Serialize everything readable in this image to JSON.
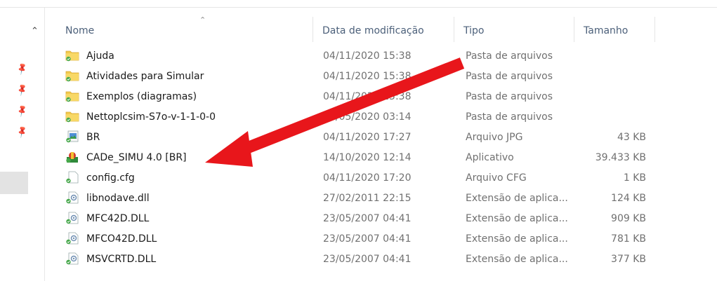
{
  "columns": {
    "name": "Nome",
    "date": "Data de modificação",
    "type": "Tipo",
    "size": "Tamanho"
  },
  "icons": {
    "folder": "folder-icon",
    "image": "image-file-icon",
    "app": "application-icon",
    "config": "config-file-icon",
    "dll": "dll-file-icon",
    "pin": "pin-icon"
  },
  "colors": {
    "arrow": "#e8161b",
    "header_text": "#4c607a",
    "folder_yellow": "#f3c94c"
  },
  "files": [
    {
      "name": "Ajuda",
      "date": "04/11/2020 15:38",
      "type": "Pasta de arquivos",
      "size": "",
      "icon": "folder"
    },
    {
      "name": "Atividades para Simular",
      "date": "04/11/2020 15:38",
      "type": "Pasta de arquivos",
      "size": "",
      "icon": "folder"
    },
    {
      "name": "Exemplos (diagramas)",
      "date": "04/11/2020 15:38",
      "type": "Pasta de arquivos",
      "size": "",
      "icon": "folder"
    },
    {
      "name": "Nettoplcsim-S7o-v-1-1-0-0",
      "date": "23/05/2020 03:14",
      "type": "Pasta de arquivos",
      "size": "",
      "icon": "folder"
    },
    {
      "name": "BR",
      "date": "04/11/2020 17:27",
      "type": "Arquivo JPG",
      "size": "43 KB",
      "icon": "image"
    },
    {
      "name": "CADe_SIMU 4.0 [BR]",
      "date": "14/10/2020 12:14",
      "type": "Aplicativo",
      "size": "39.433 KB",
      "icon": "app"
    },
    {
      "name": "config.cfg",
      "date": "04/11/2020 17:20",
      "type": "Arquivo CFG",
      "size": "1 KB",
      "icon": "config"
    },
    {
      "name": "libnodave.dll",
      "date": "27/02/2011 22:15",
      "type": "Extensão de aplica...",
      "size": "124 KB",
      "icon": "dll"
    },
    {
      "name": "MFC42D.DLL",
      "date": "23/05/2007 04:41",
      "type": "Extensão de aplica...",
      "size": "909 KB",
      "icon": "dll"
    },
    {
      "name": "MFCO42D.DLL",
      "date": "23/05/2007 04:41",
      "type": "Extensão de aplica...",
      "size": "781 KB",
      "icon": "dll"
    },
    {
      "name": "MSVCRTD.DLL",
      "date": "23/05/2007 04:41",
      "type": "Extensão de aplica...",
      "size": "377 KB",
      "icon": "dll"
    }
  ]
}
